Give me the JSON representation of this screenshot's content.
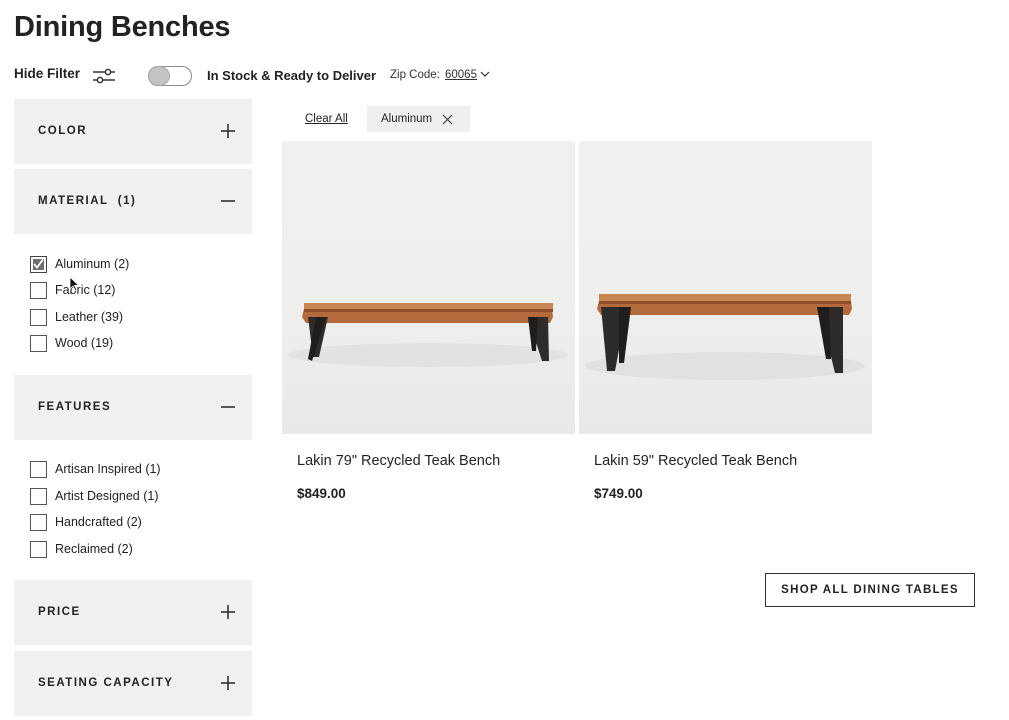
{
  "page": {
    "title": "Dining Benches"
  },
  "toolbar": {
    "hide_filter_label": "Hide Filter",
    "in_stock_toggle_on": false,
    "in_stock_label": "In Stock & Ready to Deliver",
    "zip_label": "Zip Code:",
    "zip_value": "60065"
  },
  "facets": {
    "color": {
      "label": "COLOR",
      "expanded": false
    },
    "material": {
      "label": "MATERIAL  (1)",
      "expanded": true,
      "options": [
        {
          "label": "Aluminum (2)",
          "checked": true
        },
        {
          "label": "Fabric (12)",
          "checked": false
        },
        {
          "label": "Leather (39)",
          "checked": false
        },
        {
          "label": "Wood (19)",
          "checked": false
        }
      ]
    },
    "features": {
      "label": "FEATURES",
      "expanded": true,
      "options": [
        {
          "label": "Artisan Inspired (1)",
          "checked": false
        },
        {
          "label": "Artist Designed (1)",
          "checked": false
        },
        {
          "label": "Handcrafted (2)",
          "checked": false
        },
        {
          "label": "Reclaimed (2)",
          "checked": false
        }
      ]
    },
    "price": {
      "label": "PRICE",
      "expanded": false
    },
    "seating_capacity": {
      "label": "SEATING CAPACITY",
      "expanded": false
    }
  },
  "active_filters": {
    "clear_all_label": "Clear All",
    "chips": [
      {
        "label": "Aluminum"
      }
    ]
  },
  "products": [
    {
      "name": "Lakin 79\" Recycled Teak Bench",
      "price": "$849.00"
    },
    {
      "name": "Lakin 59\" Recycled Teak Bench",
      "price": "$749.00"
    }
  ],
  "cta": {
    "shop_all_label": "SHOP ALL DINING TABLES"
  },
  "colors": {
    "facet_bg": "#f2f1ef",
    "text": "#222222",
    "teak": "#b5683a",
    "legs": "#2b2b2b"
  },
  "icons": {
    "filter": "sliders-icon",
    "expand": "plus-icon",
    "collapse": "minus-icon",
    "remove_chip": "close-icon",
    "zip_dropdown": "chevron-down-icon"
  }
}
